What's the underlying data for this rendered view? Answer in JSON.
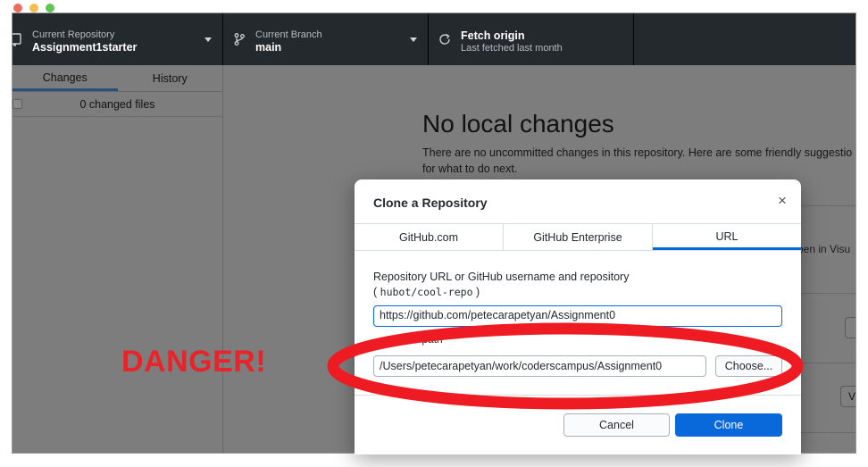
{
  "toolbar": {
    "repo_label": "Current Repository",
    "repo_value": "Assignment1starter",
    "branch_label": "Current Branch",
    "branch_value": "main",
    "fetch_label": "Fetch origin",
    "fetch_sub": "Last fetched last month"
  },
  "sidebar": {
    "tabs": [
      "Changes",
      "History"
    ],
    "changed_files": "0 changed files"
  },
  "main": {
    "title": "No local changes",
    "desc_line1": "There are no uncommitted changes in this repository. Here are some friendly suggestio",
    "desc_line2": "for what to do next.",
    "open_in": "pen in Visu",
    "side_btn": "V"
  },
  "dialog": {
    "title": "Clone a Repository",
    "close": "×",
    "tabs": [
      "GitHub.com",
      "GitHub Enterprise",
      "URL"
    ],
    "url_label": "Repository URL or GitHub username and repository",
    "url_example_open": "( ",
    "url_example_code": "hubot/cool-repo",
    "url_example_close": " )",
    "url_value": "https://github.com/petecarapetyan/Assignment0",
    "local_path_label": "ocal path",
    "path_value": "/Users/petecarapetyan/work/coderscampus/Assignment0",
    "choose_label": "Choose...",
    "cancel_label": "Cancel",
    "clone_label": "Clone"
  },
  "annotation": {
    "danger_text": "DANGER!",
    "color": "#e8242a"
  },
  "colors": {
    "toolbar_bg": "#24292e",
    "accent_blue": "#0a69da",
    "overlay_gray": "#7d7d7d"
  },
  "icons": {
    "repo": "repo-icon",
    "branch": "branch-icon",
    "fetch": "sync-icon",
    "close": "close-icon"
  }
}
